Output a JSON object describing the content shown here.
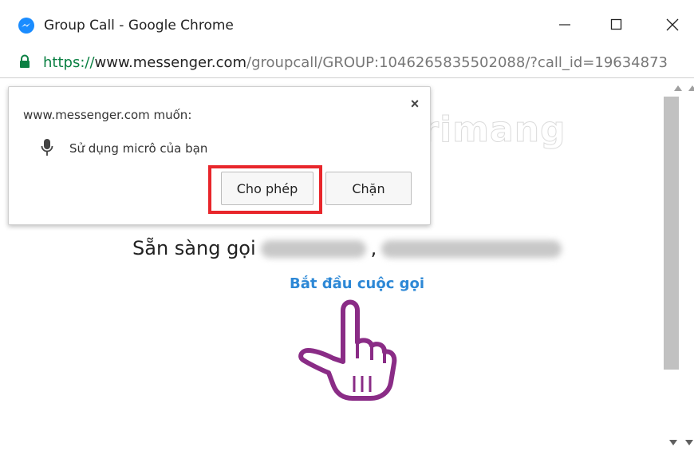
{
  "window": {
    "title": "Group Call - Google Chrome",
    "icon": "messenger-icon",
    "minimize_glyph": "—",
    "maximize_glyph": "☐",
    "close_glyph": "✕"
  },
  "address": {
    "scheme": "https://",
    "host": "www.messenger.com",
    "path": "/groupcall/GROUP:1046265835502088/?call_id=19634873"
  },
  "popup": {
    "title": "www.messenger.com muốn:",
    "permission": "Sử dụng micrô của bạn",
    "allow_label": "Cho phép",
    "block_label": "Chặn",
    "close_glyph": "×"
  },
  "page": {
    "ready_prefix": "Sẵn sàng gọi",
    "name_separator": ",",
    "start_call_link": "Bắt đầu cuộc gọi"
  },
  "watermark": {
    "text": "uantrimang"
  },
  "colors": {
    "link": "#2d88d6",
    "secure": "#0b8043",
    "highlight": "#e8262b",
    "hand": "#8a2c86"
  }
}
